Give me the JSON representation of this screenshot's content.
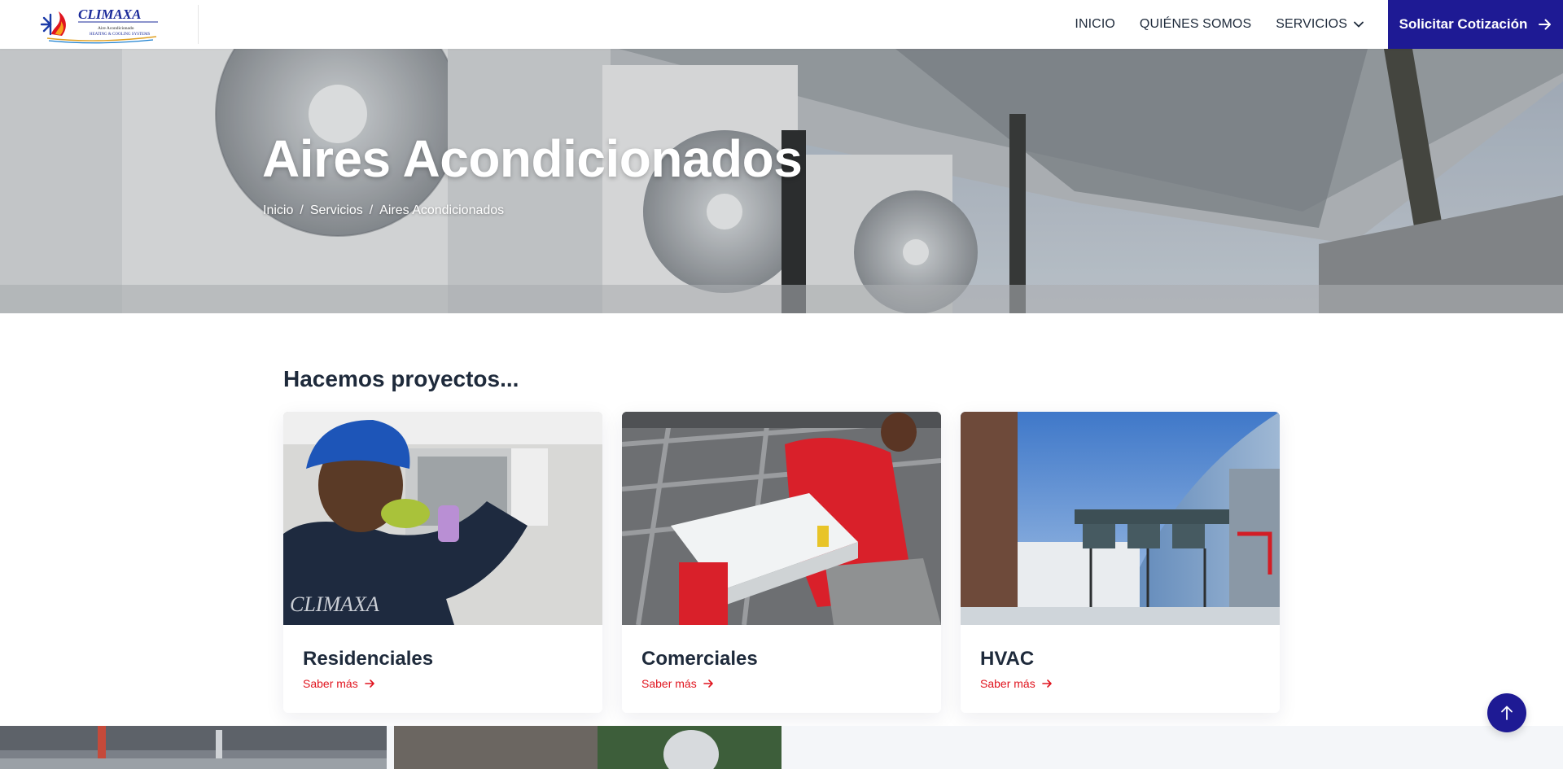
{
  "header": {
    "logo_alt": "Climaxa Aire Acondicionado Heating & Cooling Systems",
    "logo_text": "CLIMAXA",
    "logo_sub1": "Aire Acondicionado",
    "logo_sub2": "HEATING & COOLING SYSTEMS",
    "nav": [
      {
        "label": "INICIO"
      },
      {
        "label": "QUIÉNES SOMOS"
      },
      {
        "label": "SERVICIOS",
        "icon": "chevron-down-icon"
      }
    ],
    "cta_label": "Solicitar Cotización",
    "cta_icon": "arrow-right-icon",
    "cta_color": "#1e1a94"
  },
  "hero": {
    "title": "Aires Acondicionados",
    "breadcrumbs": [
      "Inicio",
      "Servicios",
      "Aires Acondicionados"
    ],
    "breadcrumb_separator": "/"
  },
  "section": {
    "title": "Hacemos proyectos..."
  },
  "cards": [
    {
      "title": "Residenciales",
      "link_label": "Saber más",
      "link_icon": "arrow-right-icon",
      "image": "technician installing indoor split unit"
    },
    {
      "title": "Comerciales",
      "link_label": "Saber más",
      "link_icon": "arrow-right-icon",
      "image": "worker in red shirt lifting cassette unit"
    },
    {
      "title": "HVAC",
      "link_label": "Saber más",
      "link_icon": "arrow-right-icon",
      "image": "rooftop HVAC equipment beside glass building"
    }
  ],
  "colors": {
    "accent": "#e0141e",
    "brand": "#1e1a94",
    "text": "#1e2a3b"
  },
  "back_to_top_icon": "arrow-up-icon"
}
